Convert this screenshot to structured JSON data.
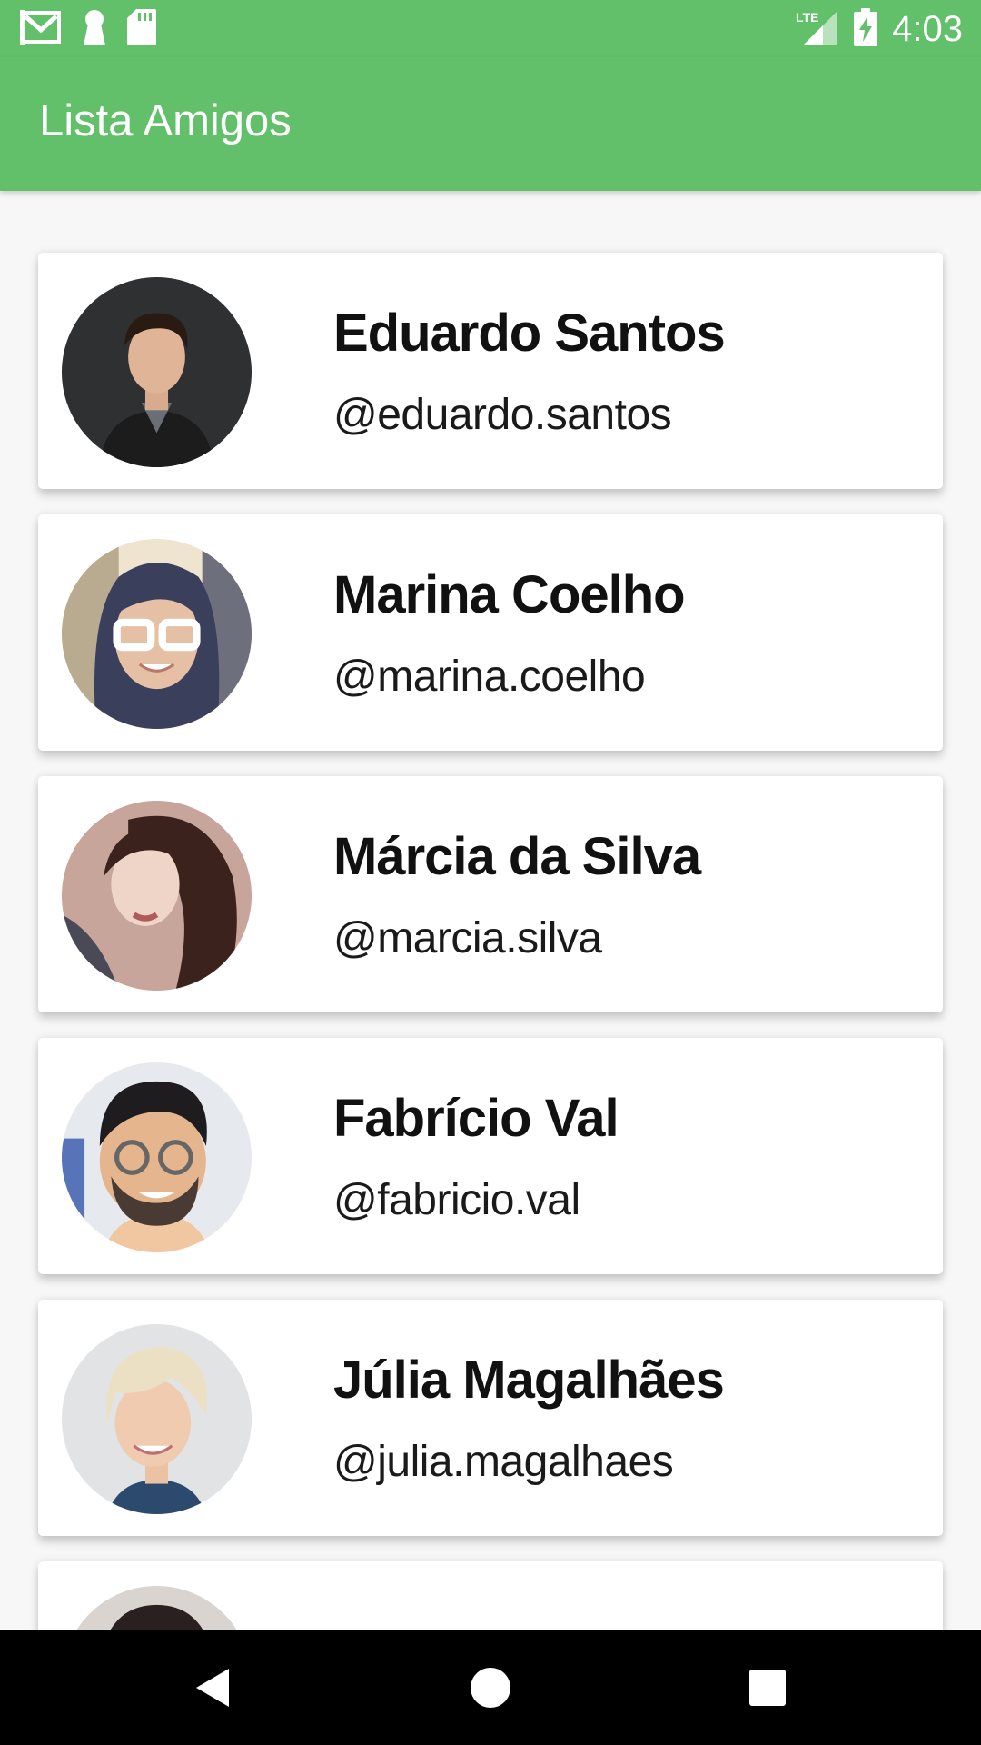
{
  "status_bar": {
    "time": "4:03",
    "network": "LTE",
    "icons": [
      "gmail-icon",
      "keyhole-icon",
      "sd-card-icon",
      "signal-icon",
      "battery-charging-icon"
    ]
  },
  "app_bar": {
    "title": "Lista Amigos"
  },
  "friends": [
    {
      "name": "Eduardo Santos",
      "handle": "@eduardo.santos"
    },
    {
      "name": "Marina Coelho",
      "handle": "@marina.coelho"
    },
    {
      "name": "Márcia da Silva",
      "handle": "@marcia.silva"
    },
    {
      "name": "Fabrício Val",
      "handle": "@fabricio.val"
    },
    {
      "name": "Júlia Magalhães",
      "handle": "@julia.magalhaes"
    },
    {
      "name": "",
      "handle": ""
    }
  ],
  "nav_bar": {
    "icons": [
      "back-icon",
      "home-icon",
      "recents-icon"
    ]
  },
  "colors": {
    "primary": "#62bf6a",
    "nav": "#000000",
    "background": "#f7f7f7",
    "card": "#ffffff"
  }
}
